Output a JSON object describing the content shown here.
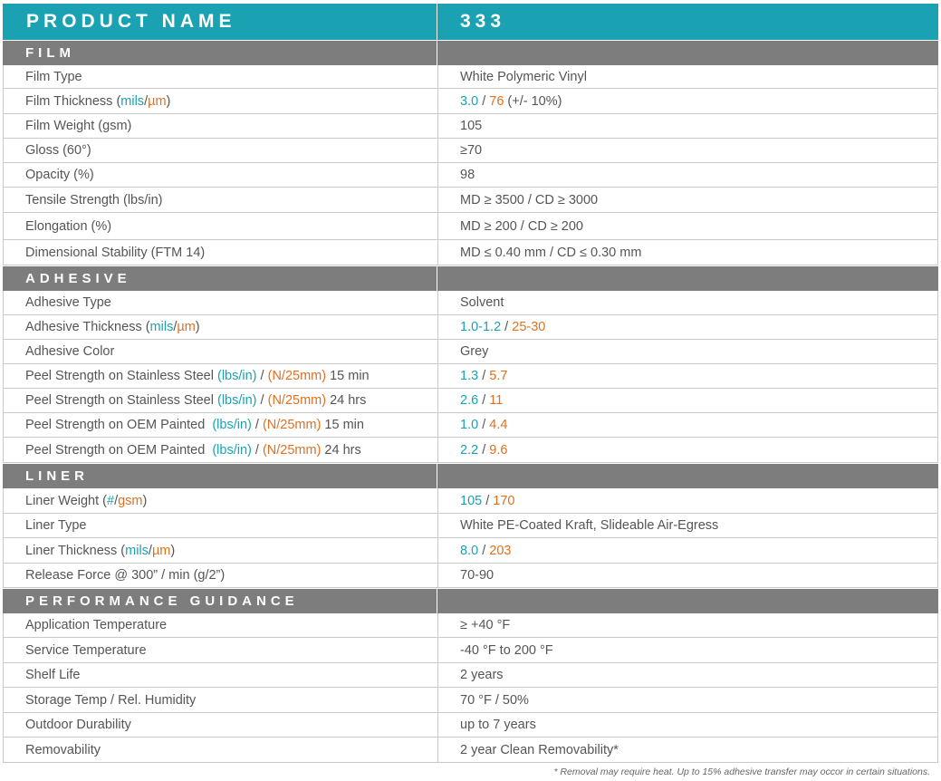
{
  "header": {
    "label": "PRODUCT NAME",
    "value": "333"
  },
  "film": {
    "title": "FILM",
    "rows": [
      {
        "label": "Film Type",
        "value": "White Polymeric Vinyl"
      },
      {
        "label_a": "Film Thickness (",
        "label_t": "mils",
        "label_b": "/",
        "label_o": "µm",
        "label_c": ")",
        "value_t": "3.0",
        "value_sep": " / ",
        "value_o": "76",
        "value_rest": " (+/- 10%)"
      },
      {
        "label": "Film Weight (gsm)",
        "value": "105"
      },
      {
        "label": "Gloss (60°)",
        "value": "≥70"
      },
      {
        "label": "Opacity (%)",
        "value": "98"
      },
      {
        "label": "Tensile Strength (lbs/in)",
        "value": "MD ≥ 3500 / CD ≥ 3000"
      },
      {
        "label": "Elongation (%)",
        "value": "MD ≥ 200 / CD ≥ 200"
      },
      {
        "label": "Dimensional Stability (FTM 14)",
        "value": "MD ≤ 0.40 mm / CD ≤ 0.30 mm"
      }
    ]
  },
  "adhesive": {
    "title": "ADHESIVE",
    "rows": [
      {
        "label": "Adhesive Type",
        "value": "Solvent"
      },
      {
        "label_a": "Adhesive Thickness (",
        "label_t": "mils",
        "label_b": "/",
        "label_o": "µm",
        "label_c": ")",
        "value_t": "1.0-1.2",
        "value_sep": " / ",
        "value_o": "25-30"
      },
      {
        "label": "Adhesive Color",
        "value": "Grey"
      },
      {
        "label_a": "Peel Strength on Stainless Steel ",
        "label_t": "(lbs/in)",
        "label_b": " / ",
        "label_o": "(N/25mm)",
        "label_c": " 15 min",
        "value_t": "1.3",
        "value_sep": " / ",
        "value_o": "5.7"
      },
      {
        "label_a": "Peel Strength on Stainless Steel ",
        "label_t": "(lbs/in)",
        "label_b": " / ",
        "label_o": "(N/25mm)",
        "label_c": " 24 hrs",
        "value_t": "2.6",
        "value_sep": " / ",
        "value_o": "11"
      },
      {
        "label_a": "Peel Strength on OEM Painted  ",
        "label_t": "(lbs/in)",
        "label_b": " / ",
        "label_o": "(N/25mm)",
        "label_c": " 15 min",
        "value_t": "1.0",
        "value_sep": " / ",
        "value_o": "4.4"
      },
      {
        "label_a": "Peel Strength on OEM Painted  ",
        "label_t": "(lbs/in)",
        "label_b": " / ",
        "label_o": "(N/25mm)",
        "label_c": " 24 hrs",
        "value_t": "2.2",
        "value_sep": " / ",
        "value_o": "9.6"
      }
    ]
  },
  "liner": {
    "title": "LINER",
    "rows": [
      {
        "label_a": "Liner Weight (",
        "label_t": "#",
        "label_b": "/",
        "label_o": "gsm",
        "label_c": ")",
        "value_t": "105",
        "value_sep": " / ",
        "value_o": "170"
      },
      {
        "label": "Liner Type",
        "value": "White PE-Coated Kraft, Slideable Air-Egress"
      },
      {
        "label_a": "Liner Thickness (",
        "label_t": "mils",
        "label_b": "/",
        "label_o": "µm",
        "label_c": ")",
        "value_t": "8.0",
        "value_sep": " / ",
        "value_o": "203"
      },
      {
        "label": "Release Force @ 300” / min (g/2”)",
        "value": "70-90"
      }
    ]
  },
  "performance": {
    "title": "PERFORMANCE GUIDANCE",
    "rows": [
      {
        "label": "Application Temperature",
        "value": "≥ +40 °F"
      },
      {
        "label": "Service Temperature",
        "value": "-40 °F to 200 °F"
      },
      {
        "label": "Shelf Life",
        "value": "2 years"
      },
      {
        "label": "Storage Temp / Rel. Humidity",
        "value": "70 °F / 50%"
      },
      {
        "label": "Outdoor Durability",
        "value": "up to 7 years"
      },
      {
        "label": "Removability",
        "value": "2 year Clean Removability*"
      }
    ]
  },
  "footnote": "* Removal may require heat. Up to 15% adhesive transfer may occor in certain situations.",
  "colors": {
    "teal": "#1aa2b3",
    "orange": "#e07020",
    "section_gray": "#7d7d7d",
    "text": "#555555"
  }
}
